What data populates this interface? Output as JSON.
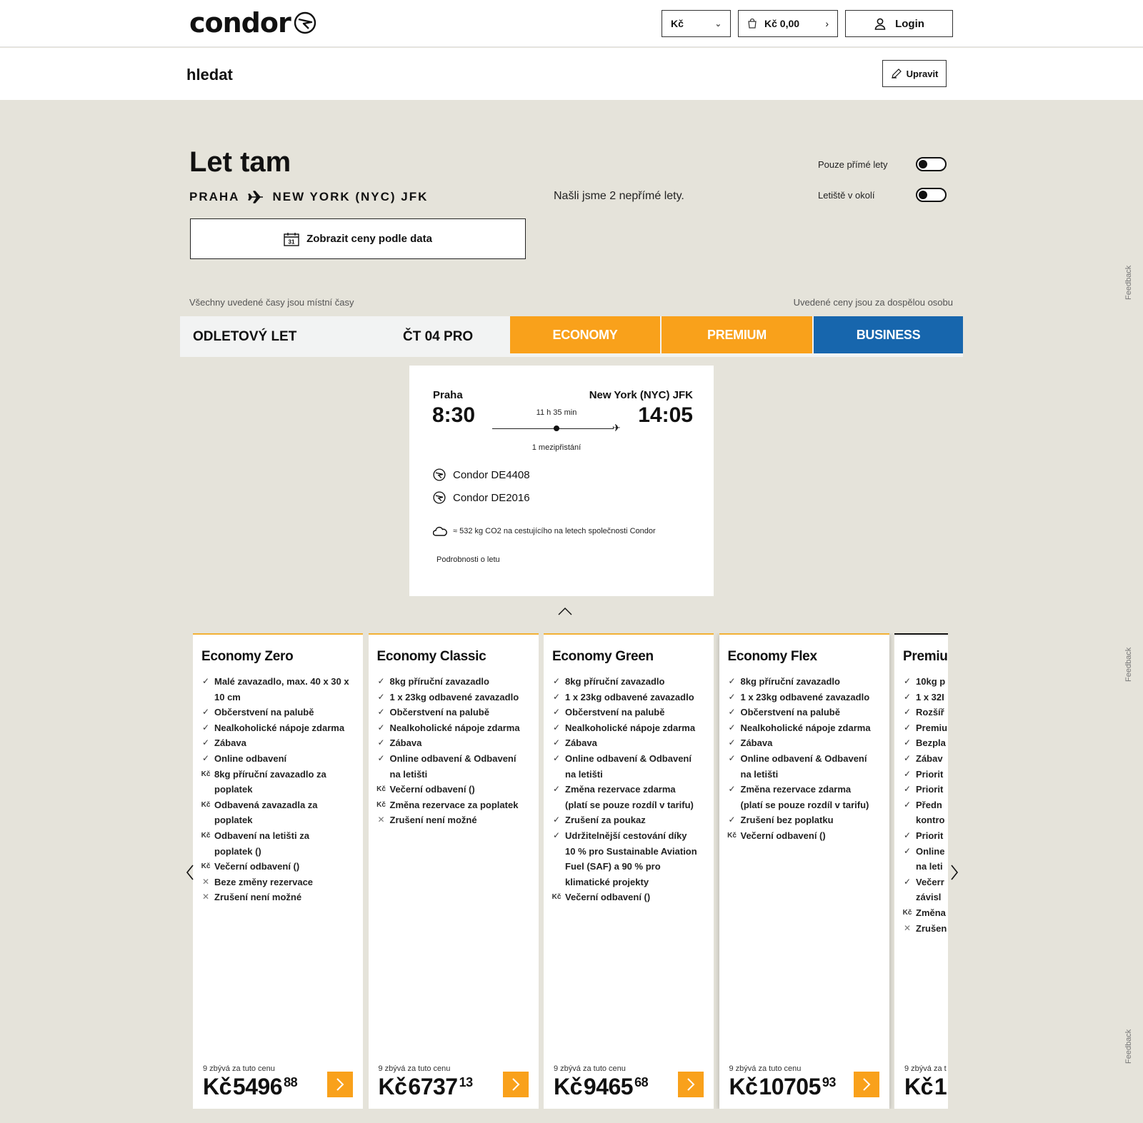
{
  "header": {
    "logo_text": "condor",
    "currency": "Kč",
    "cart_total": "Kč 0,00",
    "login_label": "Login"
  },
  "subbar": {
    "title": "hledat",
    "edit_label": "Upravit"
  },
  "search": {
    "heading": "Let tam",
    "origin": "PRAHA",
    "destination": "NEW YORK (NYC) JFK",
    "results_text": "Našli jsme 2 nepřímé lety.",
    "toggle_direct_label": "Pouze přímé lety",
    "toggle_direct_on": false,
    "toggle_nearby_label": "Letiště v okolí",
    "toggle_nearby_on": false,
    "price_by_date_label": "Zobrazit ceny podle data",
    "calendar_day": "31",
    "note_times": "Všechny uvedené časy jsou místní časy",
    "note_prices": "Uvedené ceny jsou za dospělou osobu"
  },
  "flight_bar": {
    "label": "ODLETOVÝ LET",
    "date": "ČT 04 PRO",
    "cabins": [
      "ECONOMY",
      "PREMIUM",
      "BUSINESS"
    ],
    "colors": {
      "economy": "#f9a11b",
      "premium": "#f9a11b",
      "business": "#1766ad"
    }
  },
  "flight": {
    "from_city": "Praha",
    "to_city": "New York (NYC) JFK",
    "departure": "8:30",
    "arrival": "14:05",
    "duration": "11 h 35 min",
    "stops": "1 mezipřistání",
    "carriers": [
      "Condor DE4408",
      "Condor DE2016"
    ],
    "co2": "≈ 532 kg CO2 na cestujícího na letech společnosti Condor",
    "details_link": "Podrobnosti o letu"
  },
  "fares": [
    {
      "name": "Economy Zero",
      "features": [
        {
          "mark": "check",
          "lines": [
            "Malé zavazadlo, max. 40 x 30 x",
            "10 cm"
          ]
        },
        {
          "mark": "check",
          "lines": [
            "Občerstvení na palubě"
          ]
        },
        {
          "mark": "check",
          "lines": [
            "Nealkoholické nápoje zdarma"
          ]
        },
        {
          "mark": "check",
          "lines": [
            "Zábava"
          ]
        },
        {
          "mark": "check",
          "lines": [
            "Online odbavení"
          ]
        },
        {
          "mark": "fee",
          "lines": [
            "8kg příruční zavazadlo za",
            "poplatek"
          ]
        },
        {
          "mark": "fee",
          "lines": [
            "Odbavená zavazadla za",
            "poplatek"
          ]
        },
        {
          "mark": "fee",
          "lines": [
            "Odbavení na letišti za",
            "poplatek ()"
          ]
        },
        {
          "mark": "fee",
          "lines": [
            "Večerní odbavení ()"
          ]
        },
        {
          "mark": "cross",
          "lines": [
            "Beze změny rezervace"
          ]
        },
        {
          "mark": "cross",
          "lines": [
            "Zrušení není možné"
          ]
        }
      ],
      "remaining": "9 zbývá za tuto cenu",
      "currency": "Kč",
      "price_int": "5496",
      "price_dec": "88"
    },
    {
      "name": "Economy Classic",
      "features": [
        {
          "mark": "check",
          "lines": [
            "8kg příruční zavazadlo"
          ]
        },
        {
          "mark": "check",
          "lines": [
            "1 x 23kg odbavené zavazadlo"
          ]
        },
        {
          "mark": "check",
          "lines": [
            "Občerstvení na palubě"
          ]
        },
        {
          "mark": "check",
          "lines": [
            "Nealkoholické nápoje zdarma"
          ]
        },
        {
          "mark": "check",
          "lines": [
            "Zábava"
          ]
        },
        {
          "mark": "check",
          "lines": [
            "Online odbavení & Odbavení",
            "na letišti"
          ]
        },
        {
          "mark": "fee",
          "lines": [
            "Večerní odbavení ()"
          ]
        },
        {
          "mark": "fee",
          "lines": [
            "Změna rezervace za poplatek"
          ]
        },
        {
          "mark": "cross",
          "lines": [
            "Zrušení není možné"
          ]
        }
      ],
      "remaining": "9 zbývá za tuto cenu",
      "currency": "Kč",
      "price_int": "6737",
      "price_dec": "13"
    },
    {
      "name": "Economy Green",
      "features": [
        {
          "mark": "check",
          "lines": [
            "8kg příruční zavazadlo"
          ]
        },
        {
          "mark": "check",
          "lines": [
            "1 x 23kg odbavené zavazadlo"
          ]
        },
        {
          "mark": "check",
          "lines": [
            "Občerstvení na palubě"
          ]
        },
        {
          "mark": "check",
          "lines": [
            "Nealkoholické nápoje zdarma"
          ]
        },
        {
          "mark": "check",
          "lines": [
            "Zábava"
          ]
        },
        {
          "mark": "check",
          "lines": [
            "Online odbavení & Odbavení",
            "na letišti"
          ]
        },
        {
          "mark": "check",
          "lines": [
            "Změna rezervace zdarma",
            "(platí se pouze rozdíl v tarifu)"
          ]
        },
        {
          "mark": "check",
          "lines": [
            "Zrušení za poukaz"
          ]
        },
        {
          "mark": "check",
          "lines": [
            "Udržitelnější cestování díky",
            "10 % pro Sustainable Aviation",
            "Fuel (SAF) a 90 % pro",
            "klimatické projekty"
          ]
        },
        {
          "mark": "fee",
          "lines": [
            "Večerní odbavení ()"
          ]
        }
      ],
      "remaining": "9 zbývá za tuto cenu",
      "currency": "Kč",
      "price_int": "9465",
      "price_dec": "68"
    },
    {
      "name": "Economy Flex",
      "features": [
        {
          "mark": "check",
          "lines": [
            "8kg příruční zavazadlo"
          ]
        },
        {
          "mark": "check",
          "lines": [
            "1 x 23kg odbavené zavazadlo"
          ]
        },
        {
          "mark": "check",
          "lines": [
            "Občerstvení na palubě"
          ]
        },
        {
          "mark": "check",
          "lines": [
            "Nealkoholické nápoje zdarma"
          ]
        },
        {
          "mark": "check",
          "lines": [
            "Zábava"
          ]
        },
        {
          "mark": "check",
          "lines": [
            "Online odbavení & Odbavení",
            "na letišti"
          ]
        },
        {
          "mark": "check",
          "lines": [
            "Změna rezervace zdarma",
            "(platí se pouze rozdíl v tarifu)"
          ]
        },
        {
          "mark": "check",
          "lines": [
            "Zrušení bez poplatku"
          ]
        },
        {
          "mark": "fee",
          "lines": [
            "Večerní odbavení ()"
          ]
        }
      ],
      "remaining": "9 zbývá za tuto cenu",
      "currency": "Kč",
      "price_int": "10705",
      "price_dec": "93"
    },
    {
      "name": "Premiu",
      "features": [
        {
          "mark": "check",
          "lines": [
            "10kg p"
          ]
        },
        {
          "mark": "check",
          "lines": [
            "1 x 32I"
          ]
        },
        {
          "mark": "check",
          "lines": [
            "Rozšíř"
          ]
        },
        {
          "mark": "check",
          "lines": [
            "Premiu"
          ]
        },
        {
          "mark": "check",
          "lines": [
            "Bezpla"
          ]
        },
        {
          "mark": "check",
          "lines": [
            "Zábav"
          ]
        },
        {
          "mark": "check",
          "lines": [
            "Priorit"
          ]
        },
        {
          "mark": "check",
          "lines": [
            "Priorit"
          ]
        },
        {
          "mark": "check",
          "lines": [
            "Předn",
            "kontro"
          ]
        },
        {
          "mark": "check",
          "lines": [
            "Priorit"
          ]
        },
        {
          "mark": "check",
          "lines": [
            "Online",
            "na leti"
          ]
        },
        {
          "mark": "check",
          "lines": [
            "Večerr",
            "závisl"
          ]
        },
        {
          "mark": "fee",
          "lines": [
            "Změna"
          ]
        },
        {
          "mark": "cross",
          "lines": [
            "Zrušen"
          ]
        }
      ],
      "remaining": "9 zbývá za t",
      "currency": "Kč",
      "price_int": "1",
      "price_dec": ""
    }
  ],
  "icons": {
    "check": "✓",
    "fee": "Kč",
    "cross": "✕"
  },
  "feedback_label": "Feedback",
  "accent_color": "#f9a11b"
}
